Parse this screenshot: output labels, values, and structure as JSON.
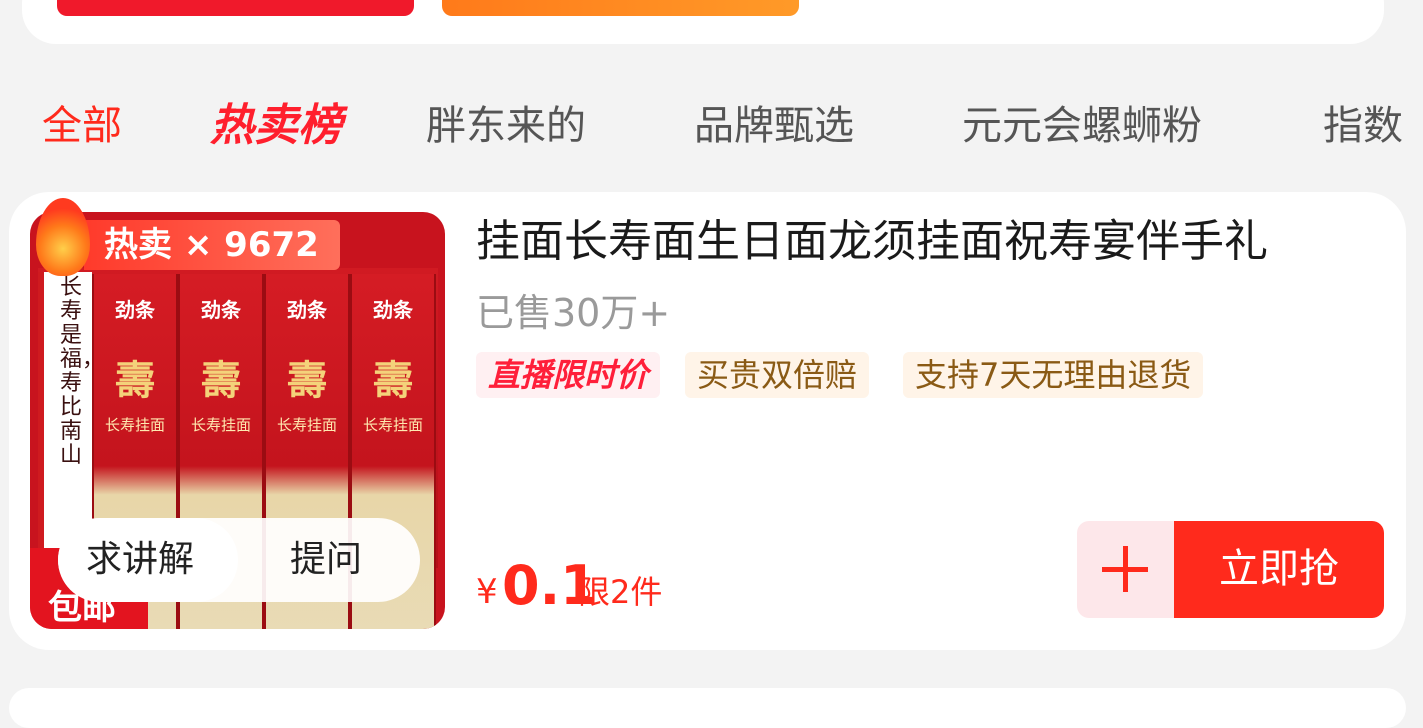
{
  "tabs": [
    {
      "label": "全部",
      "state": "active"
    },
    {
      "label": "热卖榜",
      "state": "hot"
    },
    {
      "label": "胖东来的",
      "state": "normal"
    },
    {
      "label": "品牌甄选",
      "state": "normal"
    },
    {
      "label": "元元会螺蛳粉",
      "state": "normal"
    },
    {
      "label": "指数",
      "state": "normal"
    }
  ],
  "product": {
    "title": "挂面长寿面生日面龙须挂面祝寿宴伴手礼",
    "sold": "已售30万+",
    "hot_badge": "热卖 × 9672",
    "thumb_side_text": "长寿是福，寿比南山",
    "thumb_brand": "劲条",
    "thumb_shou": "壽",
    "thumb_noodle": "长寿挂面",
    "thumb_bottom_left": "包邮",
    "tags": [
      "直播限时价",
      "买贵双倍赔",
      "支持7天无理由退货"
    ],
    "price_symbol": "¥",
    "price_value": "0.1",
    "price_limit": "限2件",
    "explain_label": "求讲解",
    "ask_label": "提问",
    "buy_label": "立即抢"
  },
  "colors": {
    "accent": "#ff2a1c",
    "tag_gold_text": "#8a5a15",
    "tag_gold_bg": "#fff4e8",
    "live_tag": "#ff1f3a"
  },
  "icons": {
    "add_to_cart": "plus-icon",
    "hot_badge": "flame-icon"
  }
}
